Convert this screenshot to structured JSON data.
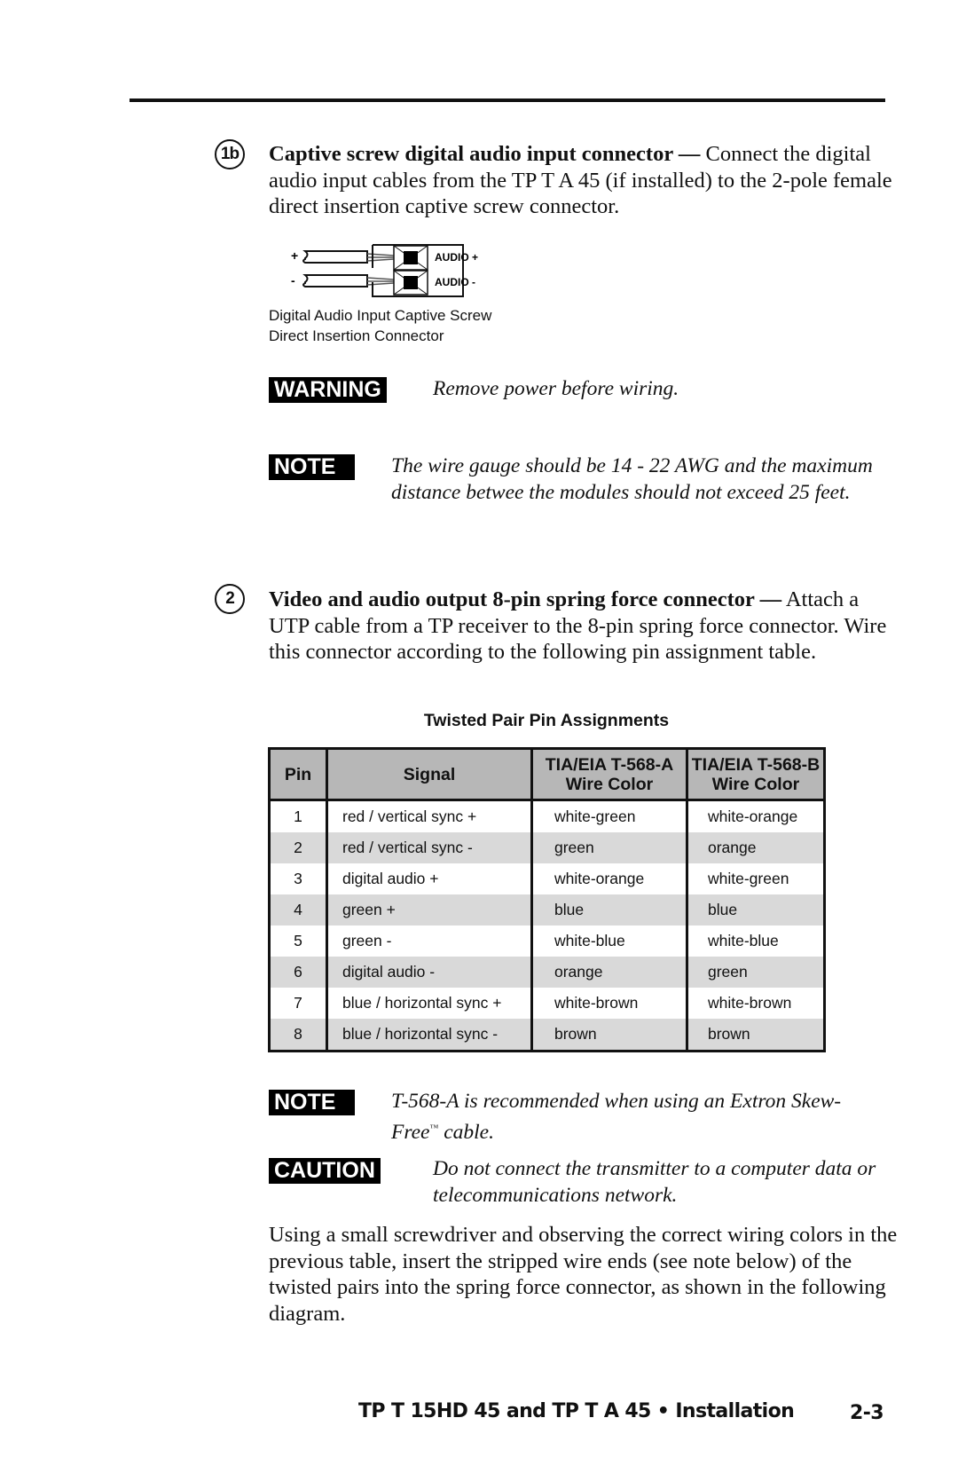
{
  "page": {
    "footer_title": "TP T 15HD 45 and TP T A 45 • Installation",
    "page_number": "2-3"
  },
  "step_1b": {
    "badge": "1b",
    "heading": "Captive screw digital audio input connector —",
    "body": " Connect the digital audio input cables from the TP T A 45 (if installed) to the 2-pole female direct insertion captive screw connector.",
    "diagram": {
      "plus_label": "+",
      "minus_label": "-",
      "pin_plus_label": "AUDIO +",
      "pin_minus_label": "AUDIO -"
    },
    "caption_line1": "Digital Audio Input Captive Screw",
    "caption_line2": "Direct Insertion Connector"
  },
  "warning": {
    "label": "WARNING",
    "text": "Remove power before wiring."
  },
  "note_1": {
    "label": "NOTE",
    "text": "The wire gauge should be 14 - 22 AWG and the maximum distance betwee the modules should not exceed 25 feet."
  },
  "step_2": {
    "badge": "2",
    "heading": "Video and audio output 8-pin spring force connector —",
    "body": " Attach a UTP cable from a TP receiver to the 8-pin spring force connector.  Wire this connector according to the following pin assignment table."
  },
  "pin_table": {
    "title": "Twisted Pair Pin Assignments",
    "headers": {
      "pin": "Pin",
      "signal": "Signal",
      "a_line1": "TIA/EIA T-568-A",
      "a_line2": "Wire Color",
      "b_line1": "TIA/EIA T-568-B",
      "b_line2": "Wire Color"
    },
    "rows": [
      {
        "pin": "1",
        "signal": "red / vertical sync +",
        "t568a": "white-green",
        "t568b": "white-orange"
      },
      {
        "pin": "2",
        "signal": "red / vertical sync -",
        "t568a": "green",
        "t568b": "orange"
      },
      {
        "pin": "3",
        "signal": "digital audio +",
        "t568a": "white-orange",
        "t568b": "white-green"
      },
      {
        "pin": "4",
        "signal": "green +",
        "t568a": "blue",
        "t568b": "blue"
      },
      {
        "pin": "5",
        "signal": "green -",
        "t568a": "white-blue",
        "t568b": "white-blue"
      },
      {
        "pin": "6",
        "signal": "digital audio -",
        "t568a": "orange",
        "t568b": "green"
      },
      {
        "pin": "7",
        "signal": "blue / horizontal sync +",
        "t568a": "white-brown",
        "t568b": "white-brown"
      },
      {
        "pin": "8",
        "signal": "blue / horizontal sync -",
        "t568a": "brown",
        "t568b": "brown"
      }
    ]
  },
  "note_2": {
    "label": "NOTE",
    "text_before_tm": "T-568-A is recommended when using an Extron Skew-Free",
    "tm": "™",
    "text_after_tm": " cable."
  },
  "caution": {
    "label": "CAUTION",
    "text": "Do not connect the transmitter to a computer data or telecommunications network."
  },
  "closing_paragraph": "Using a small screwdriver and observing the correct wiring colors in the previous table, insert the stripped wire ends (see note below) of the twisted pairs into the spring force connector, as shown in the following diagram."
}
